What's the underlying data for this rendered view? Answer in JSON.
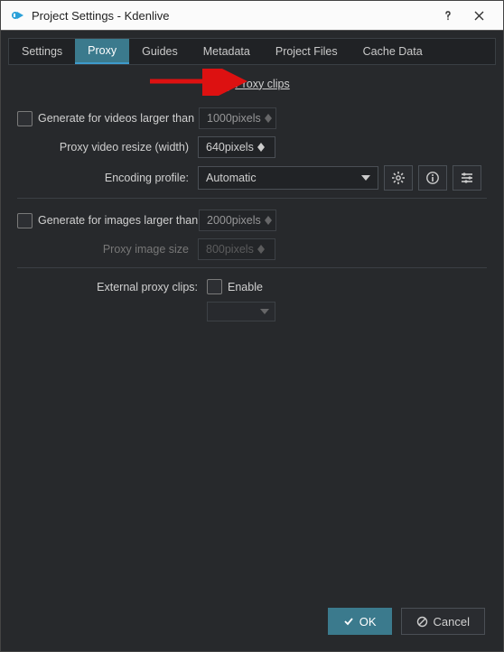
{
  "window": {
    "title": "Project Settings - Kdenlive"
  },
  "tabs": {
    "settings": "Settings",
    "proxy": "Proxy",
    "guides": "Guides",
    "metadata": "Metadata",
    "project_files": "Project Files",
    "cache_data": "Cache Data"
  },
  "proxy": {
    "proxy_clips_label": "Proxy clips",
    "gen_videos_label": "Generate for videos larger than",
    "gen_videos_value": "1000pixels",
    "video_resize_label": "Proxy video resize (width)",
    "video_resize_value": "640pixels",
    "encoding_profile_label": "Encoding profile:",
    "encoding_profile_value": "Automatic",
    "gen_images_label": "Generate for images larger than",
    "gen_images_value": "2000pixels",
    "image_size_label": "Proxy image size",
    "image_size_value": "800pixels",
    "external_label": "External proxy clips:",
    "enable_label": "Enable"
  },
  "buttons": {
    "ok": "OK",
    "cancel": "Cancel"
  },
  "icons": {
    "gear": "gear-icon",
    "info": "info-icon",
    "sliders": "sliders-icon"
  }
}
